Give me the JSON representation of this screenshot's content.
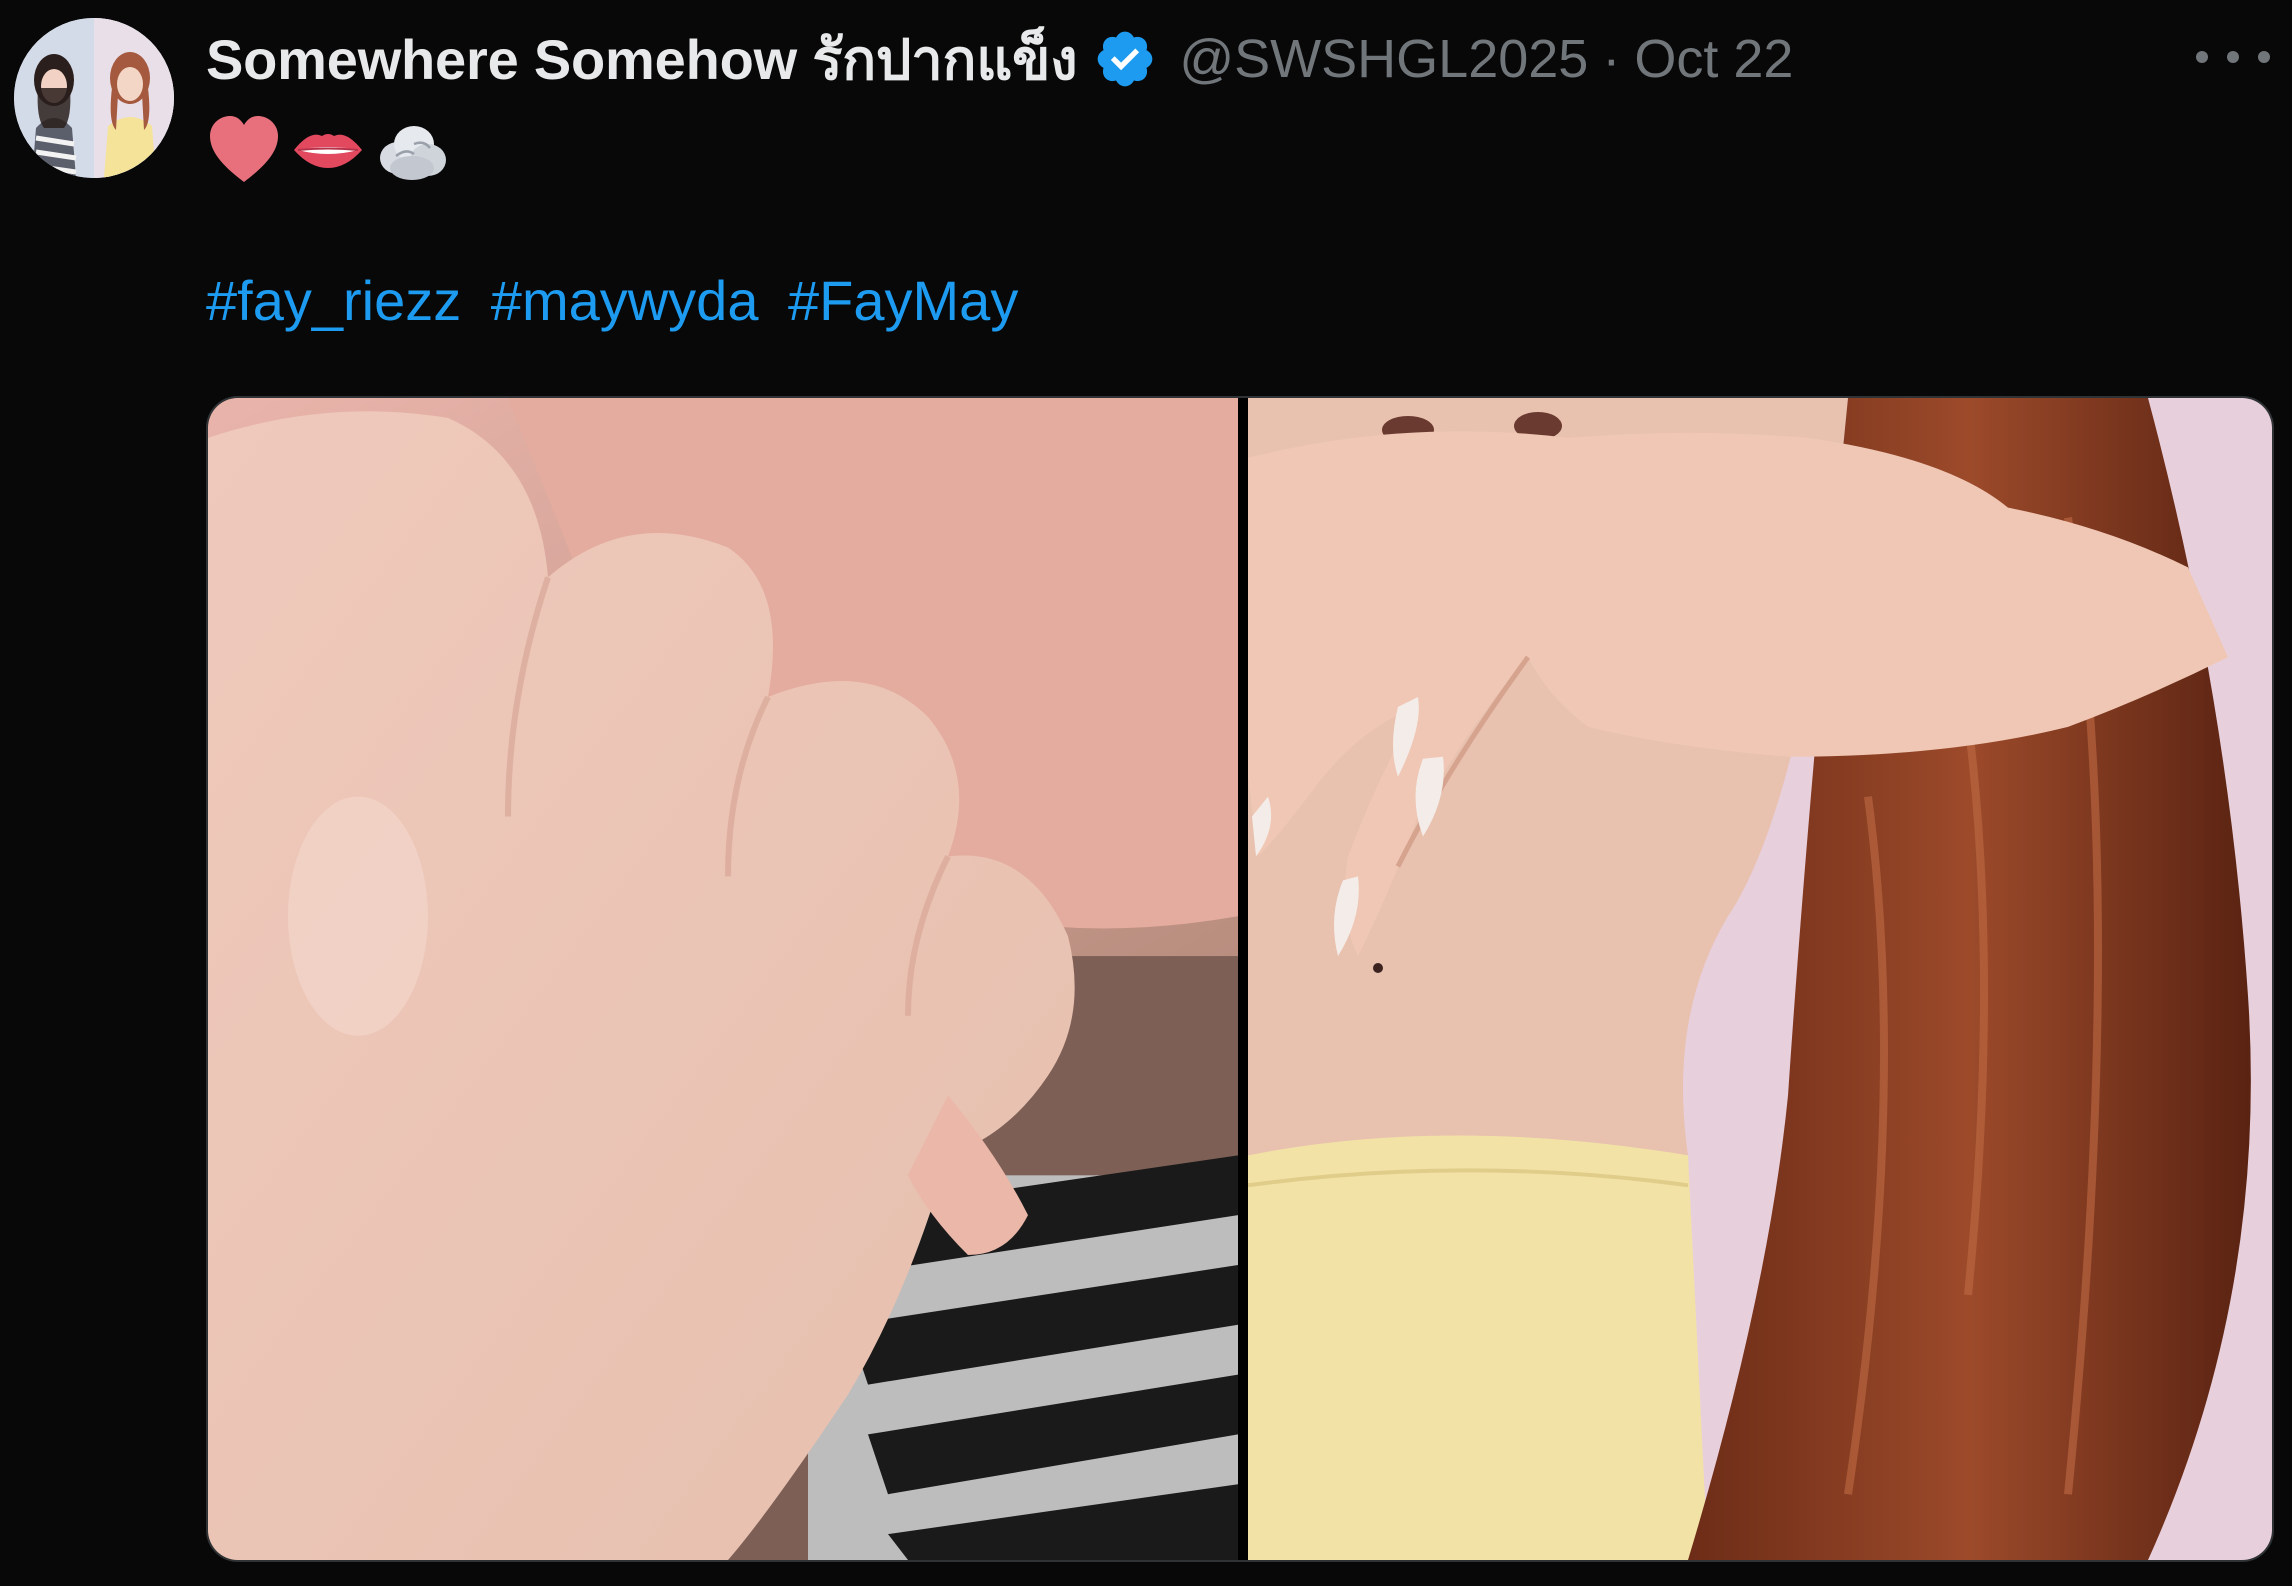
{
  "tweet": {
    "display_name": "Somewhere Somehow รักปากแข็ง",
    "handle": "@SWSHGL2025",
    "separator": "·",
    "date": "Oct 22",
    "hashtags": [
      "#fay_riezz",
      "#maywyda",
      "#FayMay"
    ]
  },
  "emoji": [
    {
      "icon": "heart-emoji",
      "color": "#e8707d"
    },
    {
      "icon": "lips-emoji",
      "color": "#e2485e"
    },
    {
      "icon": "dashing-cloud-emoji",
      "color": "#d8dce2"
    }
  ],
  "colors": {
    "background": "#080808",
    "primary_text": "#e7e9ea",
    "secondary_text": "#71767b",
    "link": "#1d9bf0",
    "verified_badge": "#1d9bf0",
    "media_border": "#2f3336"
  },
  "media": [
    {
      "icon": "photo-hand-chin",
      "description_color": "#e8c6b8"
    },
    {
      "icon": "photo-hand-lips",
      "description_color": "#f2e7a8"
    }
  ]
}
